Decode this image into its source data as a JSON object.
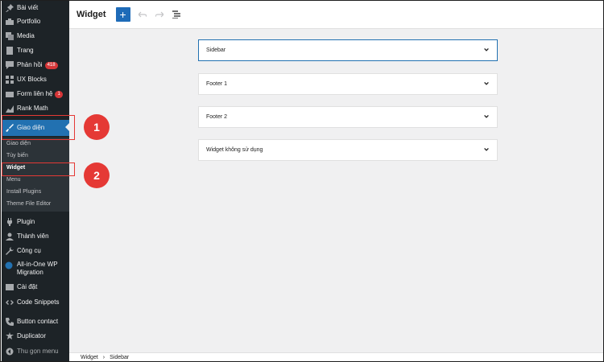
{
  "sidebar": {
    "items": [
      {
        "label": "Bài viết",
        "icon": "pin-icon"
      },
      {
        "label": "Portfolio",
        "icon": "portfolio-icon"
      },
      {
        "label": "Media",
        "icon": "media-icon"
      },
      {
        "label": "Trang",
        "icon": "page-icon"
      },
      {
        "label": "Phản hồi",
        "icon": "comments-icon",
        "badge": "418"
      },
      {
        "label": "UX Blocks",
        "icon": "blocks-icon"
      },
      {
        "label": "Form liên hệ",
        "icon": "mail-icon",
        "badge": "1"
      },
      {
        "label": "Rank Math",
        "icon": "chart-icon"
      },
      {
        "label": "Giao diện",
        "icon": "brush-icon"
      },
      {
        "label": "Plugin",
        "icon": "plugin-icon"
      },
      {
        "label": "Thành viên",
        "icon": "users-icon"
      },
      {
        "label": "Công cụ",
        "icon": "wrench-icon"
      },
      {
        "label": "All-in-One WP Migration",
        "icon": "migration-icon"
      },
      {
        "label": "Cài đặt",
        "icon": "settings-icon"
      },
      {
        "label": "Code Snippets",
        "icon": "code-icon"
      },
      {
        "label": "Button contact",
        "icon": "phone-icon"
      },
      {
        "label": "Duplicator",
        "icon": "duplicator-icon"
      },
      {
        "label": "Thu gọn menu",
        "icon": "collapse-icon"
      }
    ],
    "submenu": [
      "Giao diện",
      "Tùy biến",
      "Widget",
      "Menu",
      "Install Plugins",
      "Theme File Editor"
    ]
  },
  "annotations": {
    "step1": "1",
    "step2": "2",
    "color": "#e53935"
  },
  "header": {
    "title": "Widget",
    "add_label": "+"
  },
  "widget_areas": [
    "Sidebar",
    "Footer 1",
    "Footer 2",
    "Widget không sử dụng"
  ],
  "breadcrumb": {
    "items": [
      "Widget",
      "Sidebar"
    ],
    "separator": "›"
  },
  "colors": {
    "sidebar_bg": "#1d2327",
    "active": "#2271b1",
    "accent": "#1e6bb8"
  }
}
